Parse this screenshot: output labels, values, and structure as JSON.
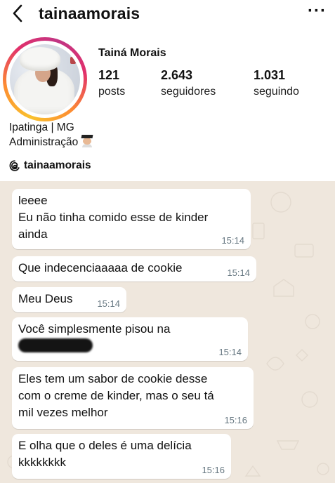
{
  "header": {
    "username": "tainaamorais",
    "more_label": "···"
  },
  "profile": {
    "display_name": "Tainá Morais",
    "stats": [
      {
        "value": "121",
        "label": "posts"
      },
      {
        "value": "2.643",
        "label": "seguidores"
      },
      {
        "value": "1.031",
        "label": "seguindo"
      }
    ],
    "bio_line1": "Ipatinga | MG",
    "bio_line2": "Administração",
    "threads_handle": "tainaamorais"
  },
  "chat": {
    "messages": [
      {
        "lines": [
          "leeee",
          "Eu não tinha comido esse de kinder",
          "ainda"
        ],
        "time": "15:14"
      },
      {
        "lines": [
          "Que indecenciaaaaa de cookie"
        ],
        "time": "15:14"
      },
      {
        "lines": [
          "Meu Deus"
        ],
        "time": "15:14"
      },
      {
        "lines": [
          "Você simplesmente pisou na"
        ],
        "time": "15:14",
        "redacted": true
      },
      {
        "lines": [
          "Eles tem um sabor de cookie desse",
          "com o creme de kinder, mas o seu tá",
          "mil vezes melhor"
        ],
        "time": "15:16"
      },
      {
        "lines": [
          "E olha que o deles é uma delícia",
          "kkkkkkkk"
        ],
        "time": "15:16"
      }
    ]
  },
  "colors": {
    "chat_bg": "#efe7dd",
    "bubble": "#ffffff",
    "time": "#667781"
  }
}
